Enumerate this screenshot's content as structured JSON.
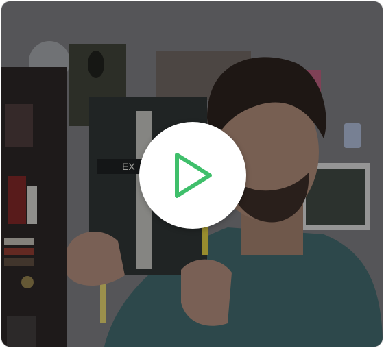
{
  "video": {
    "book_cover_text": "EX",
    "play_label": "Play video"
  },
  "colors": {
    "accent": "#3fbf6b",
    "play_bg": "#ffffff"
  },
  "icons": {
    "play": "play-icon"
  }
}
